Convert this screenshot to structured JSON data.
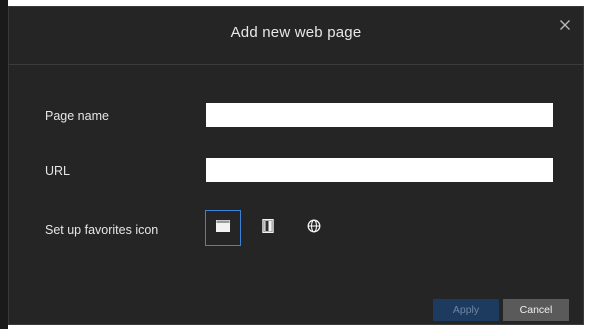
{
  "dialog": {
    "title": "Add new web page",
    "close_icon": "close-icon"
  },
  "form": {
    "page_name_label": "Page name",
    "page_name_value": "",
    "url_label": "URL",
    "url_value": "",
    "favicon_label": "Set up favorites icon",
    "favicon_options": [
      {
        "icon": "browser-window-icon",
        "selected": true
      },
      {
        "icon": "door-icon",
        "selected": false
      },
      {
        "icon": "globe-icon",
        "selected": false
      }
    ]
  },
  "buttons": {
    "apply_label": "Apply",
    "cancel_label": "Cancel"
  },
  "colors": {
    "dialog_background": "#252525",
    "accent": "#3a83d6",
    "apply_disabled": "#1d3a5f",
    "cancel": "#5a5a5a"
  }
}
